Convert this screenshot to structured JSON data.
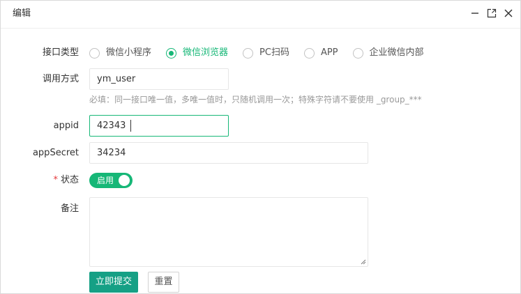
{
  "dialog": {
    "title": "编辑",
    "controls": [
      "minimize-icon",
      "maximize-icon",
      "close-icon"
    ]
  },
  "form": {
    "interface_type": {
      "label": "接口类型",
      "options": [
        "微信小程序",
        "微信浏览器",
        "PC扫码",
        "APP",
        "企业微信内部"
      ],
      "selected": "微信浏览器"
    },
    "call_method": {
      "label": "调用方式",
      "value": "ym_user",
      "hint": "必填：同一接口唯一值，多唯一值时，只随机调用一次；特殊字符请不要使用 _group_***"
    },
    "appid": {
      "label": "appid",
      "value": "42343"
    },
    "appsecret": {
      "label": "appSecret",
      "value": "34234"
    },
    "status": {
      "required_mark": "*",
      "label": "状态",
      "switch_text": "启用",
      "on": true
    },
    "remark": {
      "label": "备注",
      "value": ""
    },
    "buttons": {
      "submit": "立即提交",
      "reset": "重置"
    }
  },
  "colors": {
    "accent": "#16b777",
    "primary_button": "#16a085",
    "required": "#e4393c",
    "hint": "#999999"
  }
}
